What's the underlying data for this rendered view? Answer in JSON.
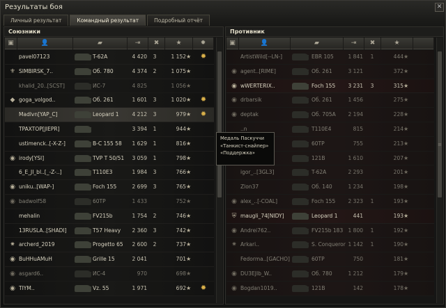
{
  "window": {
    "title": "Результаты боя",
    "close_glyph": "✕"
  },
  "tabs": [
    {
      "label": "Личный результат",
      "active": false
    },
    {
      "label": "Командный результат",
      "active": true
    },
    {
      "label": "Подробный отчёт",
      "active": false
    }
  ],
  "allies": {
    "title": "Союзники",
    "columns": [
      "squad-icon",
      "player-icon",
      "tank-icon",
      "damage-icon",
      "frags-icon",
      "xp-icon",
      "achievement-icon"
    ],
    "rows": [
      {
        "name": "pavel07123",
        "vehicle": "T-62A",
        "damage": "4 420",
        "frags": "3",
        "xp": "1 152",
        "star": "★",
        "icon": "",
        "medal": "✹",
        "hl": false,
        "dead": false
      },
      {
        "name": "SIMBIRSK_7..",
        "vehicle": "Об. 780",
        "damage": "4 374",
        "frags": "2",
        "xp": "1 075",
        "star": "★",
        "icon": "⚜",
        "medal": "",
        "hl": false,
        "dead": false
      },
      {
        "name": "khalid_20..[SCST]",
        "vehicle": "ИС-7",
        "damage": "4 825",
        "frags": "",
        "xp": "1 056",
        "star": "★",
        "icon": "",
        "medal": "",
        "hl": false,
        "dead": true
      },
      {
        "name": "goga_volgod..",
        "vehicle": "Об. 261",
        "damage": "1 601",
        "frags": "3",
        "xp": "1 020",
        "star": "★",
        "icon": "◆",
        "medal": "✹",
        "hl": false,
        "dead": false
      },
      {
        "name": "Madlvn[YAP_C]",
        "vehicle": "Leopard 1",
        "damage": "4 212",
        "frags": "3",
        "xp": "979",
        "star": "★",
        "icon": "",
        "medal": "✹",
        "hl": true,
        "dead": false
      },
      {
        "name": "TPAXTOP[JIEPR]",
        "vehicle": "",
        "damage": "3 394",
        "frags": "1",
        "xp": "944",
        "star": "★",
        "icon": "",
        "medal": "",
        "hl": false,
        "dead": false
      },
      {
        "name": "ustimenck..[-X-Z-]",
        "vehicle": "B-C 155 58",
        "damage": "1 629",
        "frags": "1",
        "xp": "816",
        "star": "★",
        "icon": "",
        "medal": "",
        "hl": false,
        "dead": false
      },
      {
        "name": "irody[YSI]",
        "vehicle": "TVP T 50/51",
        "damage": "3 059",
        "frags": "1",
        "xp": "798",
        "star": "★",
        "icon": "◉",
        "medal": "",
        "hl": false,
        "dead": false
      },
      {
        "name": "6_E_JI_bl..[_-Z-..]",
        "vehicle": "T110E3",
        "damage": "1 984",
        "frags": "3",
        "xp": "766",
        "star": "★",
        "icon": "",
        "medal": "",
        "hl": false,
        "dead": false
      },
      {
        "name": "uniku..[WAP-]",
        "vehicle": "Foch 155",
        "damage": "2 699",
        "frags": "3",
        "xp": "765",
        "star": "★",
        "icon": "◉",
        "medal": "",
        "hl": false,
        "dead": false
      },
      {
        "name": "badwolf58",
        "vehicle": "60TP",
        "damage": "1 433",
        "frags": "",
        "xp": "752",
        "star": "★",
        "icon": "◉",
        "medal": "",
        "hl": false,
        "dead": true
      },
      {
        "name": "mehalin",
        "vehicle": "FV215b",
        "damage": "1 754",
        "frags": "2",
        "xp": "746",
        "star": "★",
        "icon": "",
        "medal": "",
        "hl": false,
        "dead": false
      },
      {
        "name": "13RUSLA..[SHADI]",
        "vehicle": "T57 Heavy",
        "damage": "2 360",
        "frags": "3",
        "xp": "742",
        "star": "★",
        "icon": "",
        "medal": "",
        "hl": false,
        "dead": false
      },
      {
        "name": "archerd_2019",
        "vehicle": "Progetto 65",
        "damage": "2 600",
        "frags": "2",
        "xp": "737",
        "star": "★",
        "icon": "✷",
        "medal": "",
        "hl": false,
        "dead": false
      },
      {
        "name": "BuHHuAMuH",
        "vehicle": "Grille 15",
        "damage": "2 041",
        "frags": "",
        "xp": "701",
        "star": "★",
        "icon": "◉",
        "medal": "",
        "hl": false,
        "dead": false
      },
      {
        "name": "asgard6..",
        "vehicle": "ИС-4",
        "damage": "970",
        "frags": "",
        "xp": "698",
        "star": "★",
        "icon": "◉",
        "medal": "",
        "hl": false,
        "dead": true
      },
      {
        "name": "TIYM..",
        "vehicle": "Vz. 55",
        "damage": "1 971",
        "frags": "",
        "xp": "692",
        "star": "★",
        "icon": "◉",
        "medal": "✹",
        "hl": false,
        "dead": false
      }
    ]
  },
  "enemies": {
    "title": "Противник",
    "columns": [
      "squad-icon",
      "player-icon",
      "tank-icon",
      "damage-icon",
      "frags-icon",
      "xp-icon"
    ],
    "rows": [
      {
        "name": "ArtistWild[--LN-]",
        "vehicle": "EBR 105",
        "damage": "1 841",
        "frags": "1",
        "xp": "444",
        "star": "★",
        "icon": "",
        "dead": true
      },
      {
        "name": "agent..[RIME]",
        "vehicle": "Об. 261",
        "damage": "3 121",
        "frags": "",
        "xp": "372",
        "star": "★",
        "icon": "◉",
        "dead": true
      },
      {
        "name": "wWERTERIX..",
        "vehicle": "Foch 155",
        "damage": "3 231",
        "frags": "3",
        "xp": "315",
        "star": "★",
        "icon": "◉",
        "dead": false
      },
      {
        "name": "drbarsik",
        "vehicle": "Об. 261",
        "damage": "1 456",
        "frags": "",
        "xp": "275",
        "star": "★",
        "icon": "◉",
        "dead": true
      },
      {
        "name": "deptak",
        "vehicle": "Об. 705A",
        "damage": "2 194",
        "frags": "",
        "xp": "228",
        "star": "★",
        "icon": "◉",
        "dead": true
      },
      {
        "name": "..n",
        "vehicle": "T110E4",
        "damage": "815",
        "frags": "",
        "xp": "214",
        "star": "★",
        "icon": "",
        "dead": true
      },
      {
        "name": "..[LS]",
        "vehicle": "60TP",
        "damage": "755",
        "frags": "",
        "xp": "213",
        "star": "★",
        "icon": "",
        "dead": true
      },
      {
        "name": "..[KD]",
        "vehicle": "121B",
        "damage": "1 610",
        "frags": "",
        "xp": "207",
        "star": "★",
        "icon": "",
        "dead": true
      },
      {
        "name": "igor_..[3GL3]",
        "vehicle": "T-62A",
        "damage": "2 293",
        "frags": "",
        "xp": "201",
        "star": "★",
        "icon": "",
        "dead": true
      },
      {
        "name": "Zlon37",
        "vehicle": "Об. 140",
        "damage": "1 234",
        "frags": "",
        "xp": "198",
        "star": "★",
        "icon": "",
        "dead": true
      },
      {
        "name": "alex_..[-COAL]",
        "vehicle": "Foch 155",
        "damage": "2 323",
        "frags": "1",
        "xp": "193",
        "star": "★",
        "icon": "◉",
        "dead": true
      },
      {
        "name": "maugli_74[NIDY]",
        "vehicle": "Leopard 1",
        "damage": "441",
        "frags": "",
        "xp": "193",
        "star": "★",
        "icon": "⛨",
        "dead": false
      },
      {
        "name": "Andrei762..",
        "vehicle": "FV215b 183",
        "damage": "1 800",
        "frags": "1",
        "xp": "192",
        "star": "★",
        "icon": "◉",
        "dead": true
      },
      {
        "name": "Arkari..",
        "vehicle": "S. Conqueror",
        "damage": "1 142",
        "frags": "1",
        "xp": "190",
        "star": "★",
        "icon": "✷",
        "dead": true
      },
      {
        "name": "Fedorma..[GACHO]",
        "vehicle": "60TP",
        "damage": "750",
        "frags": "",
        "xp": "181",
        "star": "★",
        "icon": "",
        "dead": true
      },
      {
        "name": "DU3EJIb_W..",
        "vehicle": "Об. 780",
        "damage": "1 212",
        "frags": "",
        "xp": "179",
        "star": "★",
        "icon": "◉",
        "dead": true
      },
      {
        "name": "Bogdan1019..",
        "vehicle": "121B",
        "damage": "142",
        "frags": "",
        "xp": "178",
        "star": "★",
        "icon": "◉",
        "dead": true
      }
    ]
  },
  "tooltip": {
    "line1": "Медаль Паскуччи",
    "line2": "«Танкист-снайпер»",
    "line3": "«Поддержка»"
  }
}
